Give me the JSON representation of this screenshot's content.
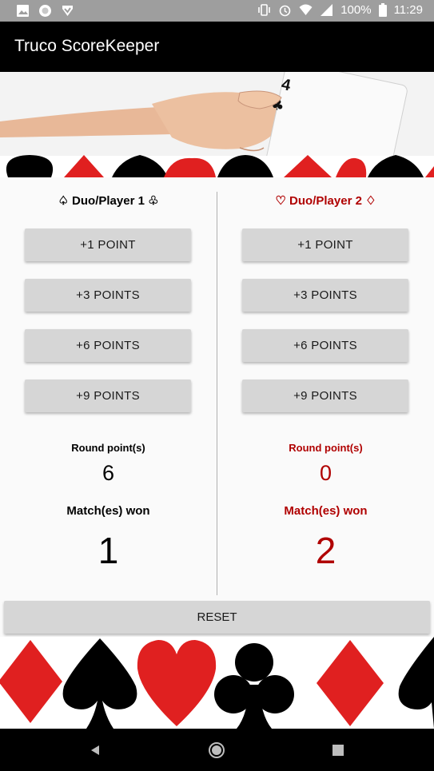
{
  "status_bar": {
    "battery": "100%",
    "time": "11:29",
    "icons": [
      "image-icon",
      "circle-icon",
      "download-icon",
      "vibrate-icon",
      "alarm-icon",
      "wifi-icon",
      "signal-icon",
      "battery-icon"
    ]
  },
  "app": {
    "title": "Truco ScoreKeeper"
  },
  "team1": {
    "name": "♤ Duo/Player 1 ♧",
    "color": "#000000",
    "buttons": [
      "+1 POINT",
      "+3 POINTS",
      "+6 POINTS",
      "+9 POINTS"
    ],
    "round_label": "Round point(s)",
    "round_value": "6",
    "matches_label": "Match(es) won",
    "matches_value": "1"
  },
  "team2": {
    "name": "♡ Duo/Player 2 ♢",
    "color": "#b00000",
    "buttons": [
      "+1 POINT",
      "+3 POINTS",
      "+6 POINTS",
      "+9 POINTS"
    ],
    "round_label": "Round point(s)",
    "round_value": "0",
    "matches_label": "Match(es) won",
    "matches_value": "2"
  },
  "reset_label": "RESET",
  "banner": {
    "card_rank": "4",
    "card_suit": "clubs"
  },
  "nav": {
    "icons": [
      "back-icon",
      "home-icon",
      "recents-icon"
    ]
  },
  "colors": {
    "suit_red": "#e02020",
    "suit_black": "#000000"
  }
}
